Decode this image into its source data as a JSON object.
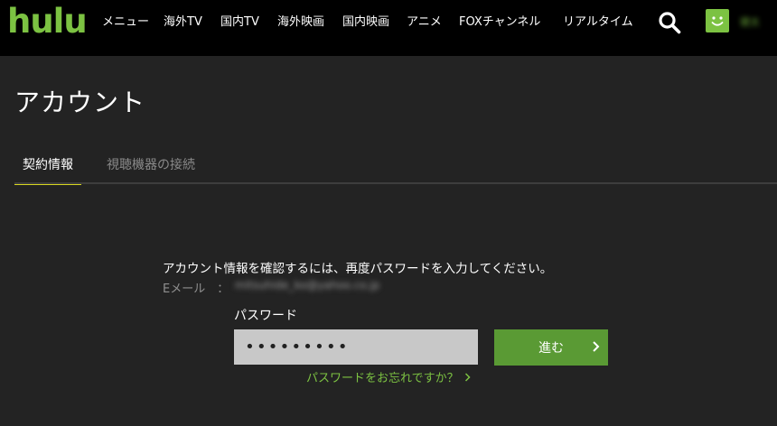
{
  "header": {
    "logo": "hulu",
    "nav": [
      "メニュー",
      "海外TV",
      "国内TV",
      "海外映画",
      "国内映画",
      "アニメ",
      "FOXチャンネル",
      "リアルタイム"
    ],
    "search_icon": "search-icon",
    "avatar_icon": "smiley-face-icon",
    "username": "健太"
  },
  "page": {
    "title": "アカウント",
    "tabs": [
      {
        "label": "契約情報",
        "active": true
      },
      {
        "label": "視聴機器の接続",
        "active": false
      }
    ]
  },
  "form": {
    "prompt": "アカウント情報を確認するには、再度パスワードを入力してください。",
    "email_label": "Eメール　：",
    "email_value": "mitsuhide_ko@yahoo.co.jp",
    "password_label": "パスワード",
    "password_value": "•••••••••",
    "submit_label": "進む",
    "forgot_link": "パスワードをお忘れですか？"
  },
  "colors": {
    "brand_green": "#7cc242",
    "button_green": "#5a9a34",
    "tab_indicator": "#d7d61f",
    "background": "#232323"
  }
}
